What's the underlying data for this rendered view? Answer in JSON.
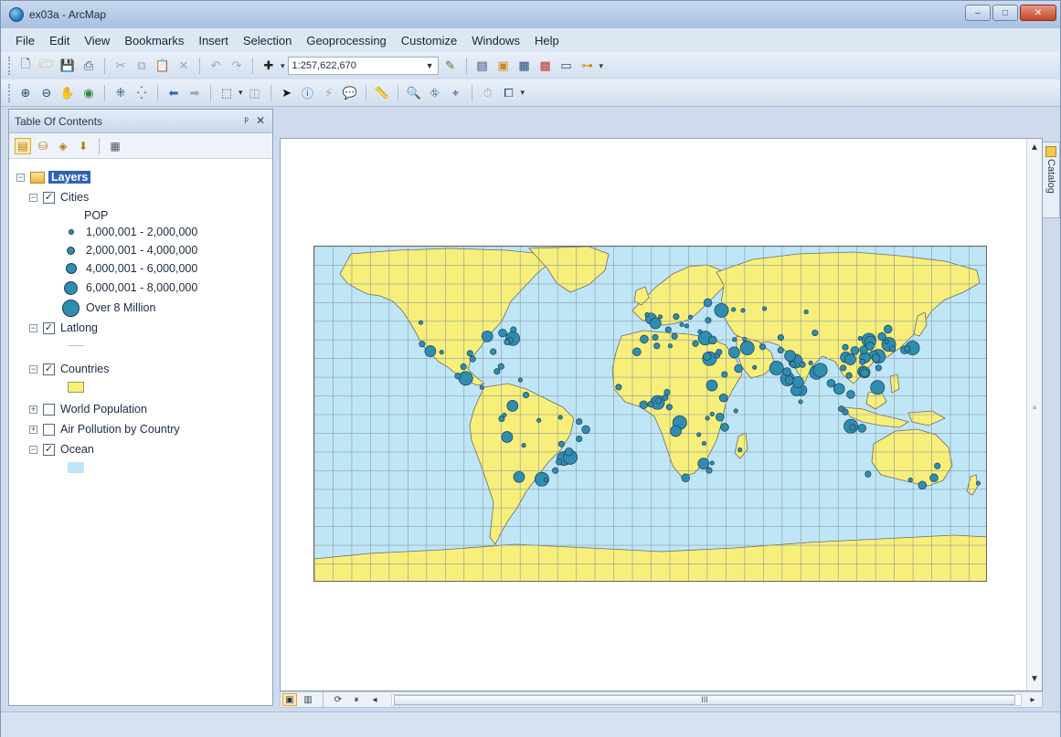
{
  "window": {
    "title": "ex03a - ArcMap",
    "controls": {
      "minimize": "–",
      "maximize": "□",
      "close": "✕"
    }
  },
  "menu": [
    "File",
    "Edit",
    "View",
    "Bookmarks",
    "Insert",
    "Selection",
    "Geoprocessing",
    "Customize",
    "Windows",
    "Help"
  ],
  "toolbar": {
    "scale": "1:257,622,670"
  },
  "toc": {
    "title": "Table Of Contents",
    "pin": "ᵖ",
    "close": "✕",
    "root_label": "Layers",
    "layers": [
      {
        "name": "Cities",
        "checked": "✓",
        "expander": "−"
      },
      {
        "name": "Latlong",
        "checked": "✓",
        "expander": "−"
      },
      {
        "name": "Countries",
        "checked": "✓",
        "expander": "−"
      },
      {
        "name": "World Population",
        "checked": "",
        "expander": "+"
      },
      {
        "name": "Air Pollution by Country",
        "checked": "",
        "expander": "+"
      },
      {
        "name": "Ocean",
        "checked": "✓",
        "expander": "−"
      }
    ],
    "pop_field": "POP",
    "legend_classes": [
      "1,000,001 - 2,000,000",
      "2,000,001 - 4,000,000",
      "4,000,001 - 6,000,000",
      "6,000,001 - 8,000,000",
      "Over 8 Million"
    ]
  },
  "colors": {
    "land": "#f7ef7a",
    "ocean": "#bfe6f7",
    "city": "#2f8db0",
    "city_outline": "#1f3c4f",
    "grid": "#8c9aa6",
    "border": "#6b6b6b"
  },
  "catalog_tab": "Catalog",
  "hscroll_grip": "III",
  "map_cities": [
    {
      "lon": -74,
      "lat": 40.7,
      "cls": 5
    },
    {
      "lon": -118,
      "lat": 34,
      "cls": 4
    },
    {
      "lon": -87.6,
      "lat": 41.9,
      "cls": 4
    },
    {
      "lon": -99.1,
      "lat": 19.4,
      "cls": 5
    },
    {
      "lon": -79.4,
      "lat": 43.7,
      "cls": 3
    },
    {
      "lon": -95.4,
      "lat": 29.8,
      "cls": 2
    },
    {
      "lon": -122.4,
      "lat": 37.8,
      "cls": 2
    },
    {
      "lon": -80.2,
      "lat": 25.8,
      "cls": 2
    },
    {
      "lon": -75.2,
      "lat": 39.9,
      "cls": 2
    },
    {
      "lon": -77,
      "lat": 38.9,
      "cls": 2
    },
    {
      "lon": -84.4,
      "lat": 33.7,
      "cls": 2
    },
    {
      "lon": -96.8,
      "lat": 32.8,
      "cls": 2
    },
    {
      "lon": -112,
      "lat": 33.4,
      "cls": 1
    },
    {
      "lon": -123.1,
      "lat": 49.3,
      "cls": 1
    },
    {
      "lon": -73.6,
      "lat": 45.5,
      "cls": 2
    },
    {
      "lon": -103.3,
      "lat": 20.7,
      "cls": 2
    },
    {
      "lon": -100.3,
      "lat": 25.7,
      "cls": 2
    },
    {
      "lon": -90.5,
      "lat": 14.6,
      "cls": 1
    },
    {
      "lon": -82.4,
      "lat": 23.1,
      "cls": 2
    },
    {
      "lon": -69.9,
      "lat": 18.5,
      "cls": 1
    },
    {
      "lon": -74.1,
      "lat": 4.7,
      "cls": 4
    },
    {
      "lon": -66.9,
      "lat": 10.5,
      "cls": 2
    },
    {
      "lon": -78.5,
      "lat": -0.2,
      "cls": 1
    },
    {
      "lon": -79.9,
      "lat": -2.2,
      "cls": 2
    },
    {
      "lon": -77,
      "lat": -12,
      "cls": 4
    },
    {
      "lon": -70.6,
      "lat": -33.4,
      "cls": 4
    },
    {
      "lon": -58.4,
      "lat": -34.6,
      "cls": 5
    },
    {
      "lon": -46.6,
      "lat": -23.5,
      "cls": 5
    },
    {
      "lon": -43.2,
      "lat": -22.9,
      "cls": 5
    },
    {
      "lon": -43.9,
      "lat": -19.9,
      "cls": 3
    },
    {
      "lon": -38.5,
      "lat": -13,
      "cls": 2
    },
    {
      "lon": -34.9,
      "lat": -8,
      "cls": 3
    },
    {
      "lon": -38.5,
      "lat": -3.7,
      "cls": 2
    },
    {
      "lon": -47.9,
      "lat": -15.8,
      "cls": 2
    },
    {
      "lon": -60,
      "lat": -3.1,
      "cls": 1
    },
    {
      "lon": -68.1,
      "lat": -16.5,
      "cls": 1
    },
    {
      "lon": -56.2,
      "lat": -34.9,
      "cls": 1
    },
    {
      "lon": -49.3,
      "lat": -25.4,
      "cls": 2
    },
    {
      "lon": -51.2,
      "lat": -30,
      "cls": 2
    },
    {
      "lon": -48.5,
      "lat": -1.5,
      "cls": 1
    },
    {
      "lon": -0.1,
      "lat": 51.5,
      "cls": 4
    },
    {
      "lon": 2.35,
      "lat": 48.9,
      "cls": 4
    },
    {
      "lon": 13.4,
      "lat": 52.5,
      "cls": 2
    },
    {
      "lon": 37.6,
      "lat": 55.8,
      "cls": 5
    },
    {
      "lon": 30.3,
      "lat": 59.9,
      "cls": 3
    },
    {
      "lon": -3.7,
      "lat": 40.4,
      "cls": 3
    },
    {
      "lon": 2.2,
      "lat": 41.4,
      "cls": 2
    },
    {
      "lon": 12.5,
      "lat": 41.9,
      "cls": 2
    },
    {
      "lon": 9.2,
      "lat": 45.5,
      "cls": 2
    },
    {
      "lon": 21,
      "lat": 52.2,
      "cls": 1
    },
    {
      "lon": 30.5,
      "lat": 50.5,
      "cls": 2
    },
    {
      "lon": 26.1,
      "lat": 44.4,
      "cls": 1
    },
    {
      "lon": 23.7,
      "lat": 38,
      "cls": 2
    },
    {
      "lon": 28.9,
      "lat": 41,
      "cls": 5
    },
    {
      "lon": 32.9,
      "lat": 39.9,
      "cls": 3
    },
    {
      "lon": -2.2,
      "lat": 53.5,
      "cls": 1
    },
    {
      "lon": 4.9,
      "lat": 52.4,
      "cls": 1
    },
    {
      "lon": 16.4,
      "lat": 48.2,
      "cls": 1
    },
    {
      "lon": 19,
      "lat": 47.5,
      "cls": 1
    },
    {
      "lon": 44.5,
      "lat": 40.2,
      "cls": 1
    },
    {
      "lon": 49.9,
      "lat": 40.4,
      "cls": 1
    },
    {
      "lon": 44,
      "lat": 56.3,
      "cls": 1
    },
    {
      "lon": 49.1,
      "lat": 55.8,
      "cls": 1
    },
    {
      "lon": 60.6,
      "lat": 56.8,
      "cls": 1
    },
    {
      "lon": 82.9,
      "lat": 55,
      "cls": 1
    },
    {
      "lon": 35.2,
      "lat": 31.8,
      "cls": 2
    },
    {
      "lon": 36.3,
      "lat": 33.5,
      "cls": 2
    },
    {
      "lon": 31.2,
      "lat": 30,
      "cls": 5
    },
    {
      "lon": 29.9,
      "lat": 31.2,
      "cls": 3
    },
    {
      "lon": 44.4,
      "lat": 33.3,
      "cls": 4
    },
    {
      "lon": 51.4,
      "lat": 35.7,
      "cls": 5
    },
    {
      "lon": 46.7,
      "lat": 24.7,
      "cls": 3
    },
    {
      "lon": 39.2,
      "lat": 21.5,
      "cls": 2
    },
    {
      "lon": 55.3,
      "lat": 25.3,
      "cls": 1
    },
    {
      "lon": 59.6,
      "lat": 36.3,
      "cls": 2
    },
    {
      "lon": 69.2,
      "lat": 34.5,
      "cls": 2
    },
    {
      "lon": 69.3,
      "lat": 41.3,
      "cls": 2
    },
    {
      "lon": 67,
      "lat": 24.9,
      "cls": 5
    },
    {
      "lon": 74.3,
      "lat": 31.5,
      "cls": 4
    },
    {
      "lon": 77.2,
      "lat": 28.6,
      "cls": 5
    },
    {
      "lon": 72.9,
      "lat": 19.1,
      "cls": 5
    },
    {
      "lon": 88.4,
      "lat": 22.6,
      "cls": 5
    },
    {
      "lon": 90.4,
      "lat": 23.8,
      "cls": 5
    },
    {
      "lon": 80.3,
      "lat": 13.1,
      "cls": 4
    },
    {
      "lon": 77.6,
      "lat": 13,
      "cls": 4
    },
    {
      "lon": 78.5,
      "lat": 17.4,
      "cls": 4
    },
    {
      "lon": 72.6,
      "lat": 23,
      "cls": 3
    },
    {
      "lon": 73.9,
      "lat": 18.5,
      "cls": 3
    },
    {
      "lon": 80.9,
      "lat": 26.8,
      "cls": 2
    },
    {
      "lon": 75.8,
      "lat": 26.9,
      "cls": 2
    },
    {
      "lon": 85.3,
      "lat": 27.7,
      "cls": 1
    },
    {
      "lon": 79.9,
      "lat": 6.9,
      "cls": 1
    },
    {
      "lon": 96.2,
      "lat": 16.8,
      "cls": 3
    },
    {
      "lon": 100.5,
      "lat": 13.8,
      "cls": 4
    },
    {
      "lon": 105.8,
      "lat": 21,
      "cls": 2
    },
    {
      "lon": 106.7,
      "lat": 10.8,
      "cls": 3
    },
    {
      "lon": 101.7,
      "lat": 3.1,
      "cls": 2
    },
    {
      "lon": 103.8,
      "lat": 1.35,
      "cls": 2
    },
    {
      "lon": 106.8,
      "lat": -6.2,
      "cls": 5
    },
    {
      "lon": 112.7,
      "lat": -7.3,
      "cls": 3
    },
    {
      "lon": 107.6,
      "lat": -6.9,
      "cls": 2
    },
    {
      "lon": 120.98,
      "lat": 14.6,
      "cls": 5
    },
    {
      "lon": 116.4,
      "lat": 39.9,
      "cls": 5
    },
    {
      "lon": 121.5,
      "lat": 31.2,
      "cls": 5
    },
    {
      "lon": 113.3,
      "lat": 23.1,
      "cls": 4
    },
    {
      "lon": 114.1,
      "lat": 22.6,
      "cls": 4
    },
    {
      "lon": 114.2,
      "lat": 22.3,
      "cls": 3
    },
    {
      "lon": 104.1,
      "lat": 30.7,
      "cls": 4
    },
    {
      "lon": 106.5,
      "lat": 29.6,
      "cls": 4
    },
    {
      "lon": 114.3,
      "lat": 30.6,
      "cls": 4
    },
    {
      "lon": 117.2,
      "lat": 39.1,
      "cls": 4
    },
    {
      "lon": 123.4,
      "lat": 41.8,
      "cls": 3
    },
    {
      "lon": 126.6,
      "lat": 45.8,
      "cls": 3
    },
    {
      "lon": 108.9,
      "lat": 34.3,
      "cls": 3
    },
    {
      "lon": 118.8,
      "lat": 32.1,
      "cls": 3
    },
    {
      "lon": 113.6,
      "lat": 34.7,
      "cls": 3
    },
    {
      "lon": 117,
      "lat": 36.7,
      "cls": 3
    },
    {
      "lon": 112.9,
      "lat": 28.2,
      "cls": 2
    },
    {
      "lon": 120.2,
      "lat": 30.3,
      "cls": 3
    },
    {
      "lon": 121.6,
      "lat": 25,
      "cls": 2
    },
    {
      "lon": 127,
      "lat": 37.6,
      "cls": 5
    },
    {
      "lon": 129,
      "lat": 35.2,
      "cls": 2
    },
    {
      "lon": 125.8,
      "lat": 39,
      "cls": 1
    },
    {
      "lon": 139.7,
      "lat": 35.7,
      "cls": 5
    },
    {
      "lon": 135.5,
      "lat": 34.7,
      "cls": 3
    },
    {
      "lon": 136.9,
      "lat": 35.2,
      "cls": 2
    },
    {
      "lon": 102.7,
      "lat": 25,
      "cls": 2
    },
    {
      "lon": 103.8,
      "lat": 36.1,
      "cls": 2
    },
    {
      "lon": 87.6,
      "lat": 43.8,
      "cls": 2
    },
    {
      "lon": 111.7,
      "lat": 40.8,
      "cls": 1
    },
    {
      "lon": 3.4,
      "lat": 6.5,
      "cls": 5
    },
    {
      "lon": 3.9,
      "lat": 7.4,
      "cls": 2
    },
    {
      "lon": -0.2,
      "lat": 5.6,
      "cls": 2
    },
    {
      "lon": -4,
      "lat": 5.3,
      "cls": 3
    },
    {
      "lon": -17.4,
      "lat": 14.7,
      "cls": 2
    },
    {
      "lon": -7.6,
      "lat": 33.6,
      "cls": 3
    },
    {
      "lon": 3.1,
      "lat": 36.8,
      "cls": 2
    },
    {
      "lon": 10.2,
      "lat": 36.8,
      "cls": 1
    },
    {
      "lon": 32.5,
      "lat": 15.6,
      "cls": 4
    },
    {
      "lon": 38.7,
      "lat": 9,
      "cls": 3
    },
    {
      "lon": 36.8,
      "lat": -1.3,
      "cls": 3
    },
    {
      "lon": 39.3,
      "lat": -6.8,
      "cls": 3
    },
    {
      "lon": 15.3,
      "lat": -4.3,
      "cls": 5
    },
    {
      "lon": 13.2,
      "lat": -8.8,
      "cls": 4
    },
    {
      "lon": 28,
      "lat": -26.2,
      "cls": 4
    },
    {
      "lon": 31,
      "lat": -29.9,
      "cls": 2
    },
    {
      "lon": 18.4,
      "lat": -33.9,
      "cls": 3
    },
    {
      "lon": 32.6,
      "lat": -25.9,
      "cls": 1
    },
    {
      "lon": 28.3,
      "lat": -15.4,
      "cls": 1
    },
    {
      "lon": 47.5,
      "lat": -18.9,
      "cls": 1
    },
    {
      "lon": 45.3,
      "lat": 2,
      "cls": 1
    },
    {
      "lon": 7.5,
      "lat": 9.1,
      "cls": 2
    },
    {
      "lon": 8.5,
      "lat": 12,
      "cls": 2
    },
    {
      "lon": 9.7,
      "lat": 4,
      "cls": 2
    },
    {
      "lon": 32.6,
      "lat": 0.3,
      "cls": 1
    },
    {
      "lon": 30.1,
      "lat": -1.9,
      "cls": 1
    },
    {
      "lon": 25.5,
      "lat": -10.7,
      "cls": 1
    },
    {
      "lon": 151.2,
      "lat": -33.9,
      "cls": 3
    },
    {
      "lon": 144.96,
      "lat": -37.8,
      "cls": 3
    },
    {
      "lon": 153,
      "lat": -27.5,
      "cls": 2
    },
    {
      "lon": 115.9,
      "lat": -31.9,
      "cls": 2
    },
    {
      "lon": 138.6,
      "lat": -34.9,
      "cls": 1
    },
    {
      "lon": 174.8,
      "lat": -36.8,
      "cls": 1
    }
  ]
}
